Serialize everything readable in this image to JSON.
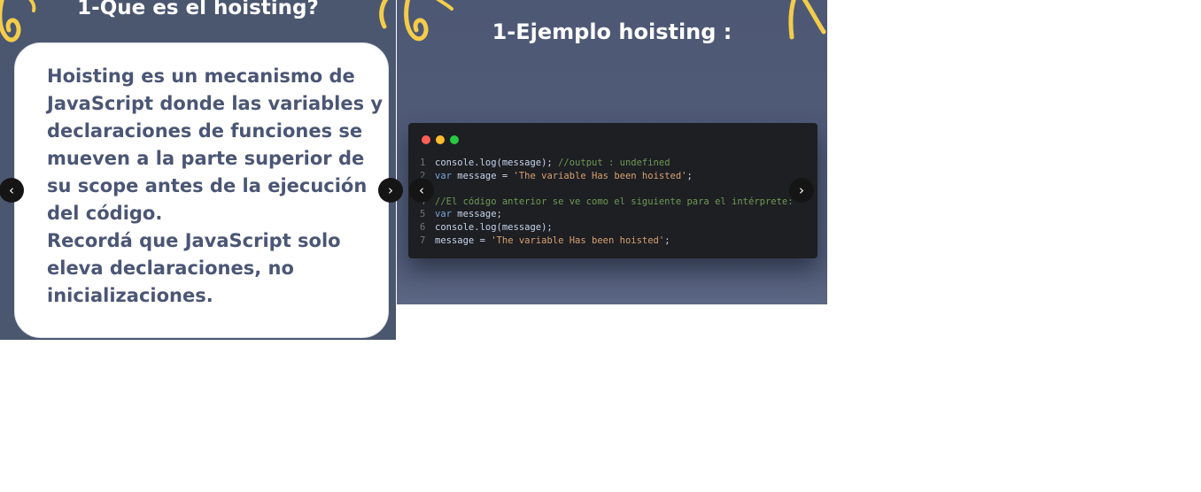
{
  "slides": [
    {
      "title": "1-Que es el hoisting?",
      "paragraph1": "Hoisting es un mecanismo de JavaScript donde las variables y declaraciones de funciones se mueven a la parte superior de su scope antes de la ejecución del código.",
      "paragraph2": "Recordá que JavaScript solo eleva declaraciones, no inicializaciones."
    },
    {
      "title": "1-Ejemplo hoisting :",
      "code": {
        "line_numbers": [
          "1",
          "2",
          "",
          "4",
          "5",
          "6",
          "7"
        ],
        "line1_fn": "console.log(message);",
        "line1_comment": "//output : undefined",
        "line2_kw": "var",
        "line2_rest": "message =",
        "line2_str": "'The variable Has been hoisted'",
        "line2_end": ";",
        "line4_comment": "//El código anterior se ve como el siguiente para el intérprete:",
        "line5_kw": "var",
        "line5_rest": "message;",
        "line6": "console.log(message);",
        "line7_rest": "message =",
        "line7_str": "'The variable Has been hoisted'",
        "line7_end": ";"
      }
    }
  ],
  "nav": {
    "prev_icon": "‹",
    "next_icon": "›"
  },
  "colors": {
    "slide_bg": "#4b566f",
    "accent_yellow": "#f3cc4a",
    "text_dark": "#4b5675",
    "code_bg": "#1d1f23",
    "dot_red": "#ff5f57",
    "dot_yellow": "#febc2e",
    "dot_green": "#28c840"
  },
  "icons": [
    "chevron-left-icon",
    "chevron-right-icon",
    "window-dot-icon",
    "yellow-doodle-icon"
  ]
}
